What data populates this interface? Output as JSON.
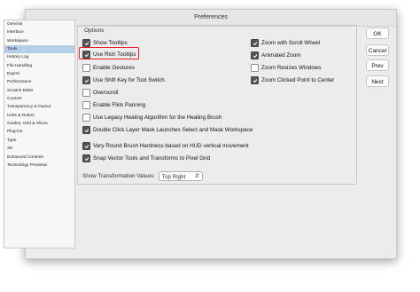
{
  "window": {
    "title": "Preferences"
  },
  "sidebar": {
    "items": [
      {
        "label": "General"
      },
      {
        "label": "Interface"
      },
      {
        "label": "Workspace"
      },
      {
        "label": "Tools"
      },
      {
        "label": "History Log"
      },
      {
        "label": "File Handling"
      },
      {
        "label": "Export"
      },
      {
        "label": "Performance"
      },
      {
        "label": "Scratch Disks"
      },
      {
        "label": "Cursors"
      },
      {
        "label": "Transparency & Gamut"
      },
      {
        "label": "Units & Rulers"
      },
      {
        "label": "Guides, Grid & Slices"
      },
      {
        "label": "Plug-ins"
      },
      {
        "label": "Type"
      },
      {
        "label": "3D"
      },
      {
        "label": "Enhanced Controls"
      },
      {
        "label": "Technology Previews"
      }
    ],
    "selected": "Tools"
  },
  "options": {
    "legend": "Options",
    "left": [
      {
        "label": "Show Tooltips",
        "checked": true
      },
      {
        "label": "Use Rich Tooltips",
        "checked": true
      },
      {
        "label": "Enable Gestures",
        "checked": false
      },
      {
        "label": "Use Shift Key for Tool Switch",
        "checked": true
      },
      {
        "label": "Overscroll",
        "checked": false
      },
      {
        "label": "Enable Flick Panning",
        "checked": false
      },
      {
        "label": "Use Legacy Healing Algorithm for the Healing Brush",
        "checked": false
      },
      {
        "label": "Double Click Layer Mask Launches Select and Mask Workspace",
        "checked": true
      },
      {
        "label": "Vary Round Brush Hardness based on HUD vertical movement",
        "checked": true
      },
      {
        "label": "Snap Vector Tools and Transforms to Pixel Grid",
        "checked": true
      }
    ],
    "right": [
      {
        "label": "Zoom with Scroll Wheel",
        "checked": true
      },
      {
        "label": "Animated Zoom",
        "checked": true
      },
      {
        "label": "Zoom Resizes Windows",
        "checked": false
      },
      {
        "label": "Zoom Clicked Point to Center",
        "checked": true
      }
    ],
    "transformation": {
      "label": "Show Transformation Values:",
      "value": "Top Right"
    }
  },
  "buttons": {
    "ok": "OK",
    "cancel": "Cancel",
    "prev": "Prev",
    "next": "Next"
  },
  "colors": {
    "highlight": "#e0212c",
    "selection": "#b5cfe8"
  }
}
